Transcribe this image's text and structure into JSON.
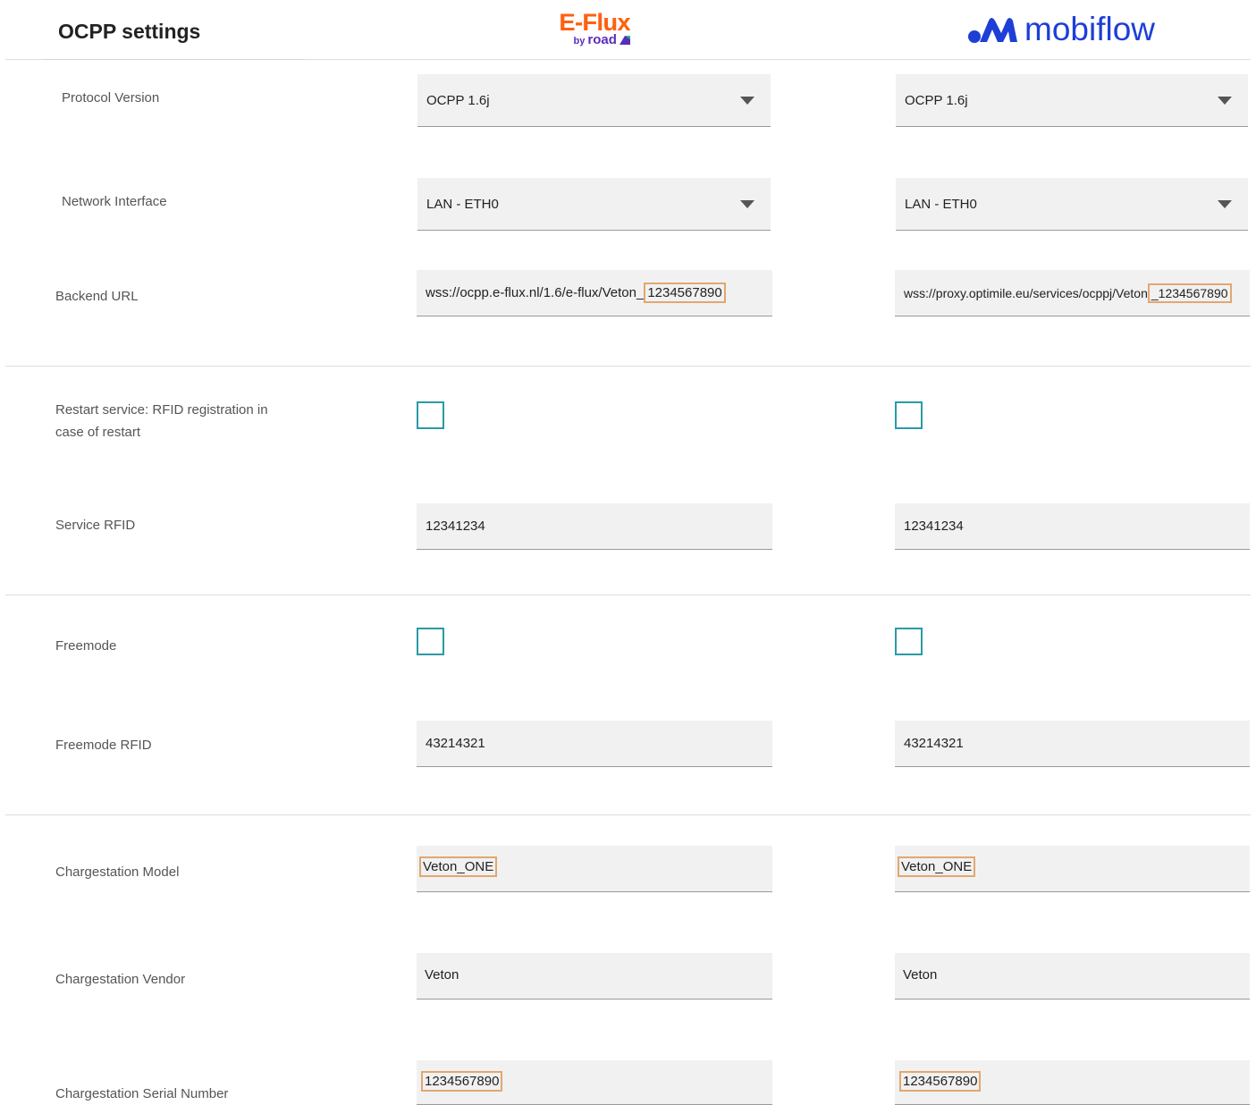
{
  "header": {
    "title": "OCPP settings",
    "eflux_logo": {
      "main": "E-Flux",
      "by": "by",
      "road": "road"
    },
    "mobiflow_logo": {
      "text": "mobiflow"
    }
  },
  "colors": {
    "eflux_orange": "#ff6010",
    "road_purple": "#5a2dbb",
    "mobiflow_blue": "#1d3fd6",
    "checkbox_teal": "#2a9aa6",
    "highlight": "#e0a870"
  },
  "labels": {
    "protocol_version": "Protocol Version",
    "network_interface": "Network Interface",
    "backend_url": "Backend URL",
    "restart_service": "Restart service: RFID registration in case of restart",
    "service_rfid": "Service RFID",
    "freemode": "Freemode",
    "freemode_rfid": "Freemode RFID",
    "chargestation_model": "Chargestation Model",
    "chargestation_vendor": "Chargestation Vendor",
    "chargestation_serial": "Chargestation Serial Number"
  },
  "eflux": {
    "protocol_version": "OCPP 1.6j",
    "network_interface": "LAN - ETH0",
    "backend_url_prefix": "wss://ocpp.e-flux.nl/1.6/e-flux/Veton_",
    "backend_url_id": "1234567890",
    "restart_checked": false,
    "service_rfid": "12341234",
    "freemode_checked": false,
    "freemode_rfid": "43214321",
    "model": "Veton_ONE",
    "vendor": "Veton",
    "serial": "1234567890"
  },
  "mobiflow": {
    "protocol_version": "OCPP 1.6j",
    "network_interface": "LAN - ETH0",
    "backend_url_prefix": "wss://proxy.optimile.eu/services/ocppj/Veton",
    "backend_url_id": "_1234567890",
    "restart_checked": false,
    "service_rfid": "12341234",
    "freemode_checked": false,
    "freemode_rfid": "43214321",
    "model": "Veton_ONE",
    "vendor": "Veton",
    "serial": "1234567890"
  }
}
